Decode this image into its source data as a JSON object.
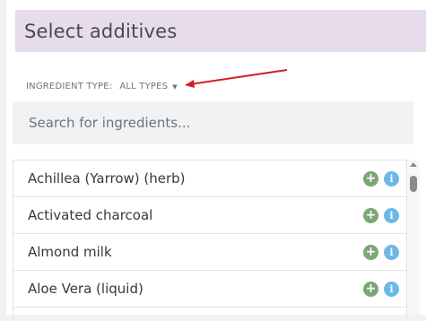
{
  "header": {
    "title": "Select additives"
  },
  "filter": {
    "label": "INGREDIENT TYPE:",
    "value": "ALL TYPES",
    "caret": "▼"
  },
  "search": {
    "placeholder": "Search for ingredients..."
  },
  "ingredients": [
    {
      "name": "Achillea (Yarrow) (herb)",
      "add_icon": "+",
      "info_icon": "i"
    },
    {
      "name": "Activated charcoal",
      "add_icon": "+",
      "info_icon": "i"
    },
    {
      "name": "Almond milk",
      "add_icon": "+",
      "info_icon": "i"
    },
    {
      "name": "Aloe Vera (liquid)",
      "add_icon": "+",
      "info_icon": "i"
    }
  ],
  "colors": {
    "header_bg": "#e6dcec",
    "add_button": "#7aa874",
    "info_button": "#6cb8e6",
    "annotation_arrow": "#d11f1f"
  }
}
